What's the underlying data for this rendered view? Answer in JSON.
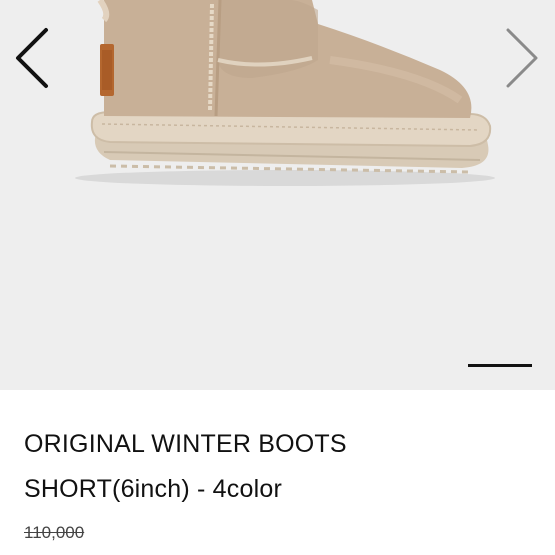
{
  "product": {
    "title_line_1": "ORIGINAL WINTER BOOTS",
    "title_line_2": "SHORT(6inch) - 4color",
    "original_price": "110,000"
  },
  "gallery": {
    "image": "boot-photo",
    "prev_icon": "chevron-left-icon",
    "next_icon": "chevron-right-icon",
    "indicator": "slide-indicator"
  },
  "colors": {
    "gallery_background": "#eeeeee",
    "boot_tan": "#c9b29a",
    "sole": "#ddd0bd"
  }
}
